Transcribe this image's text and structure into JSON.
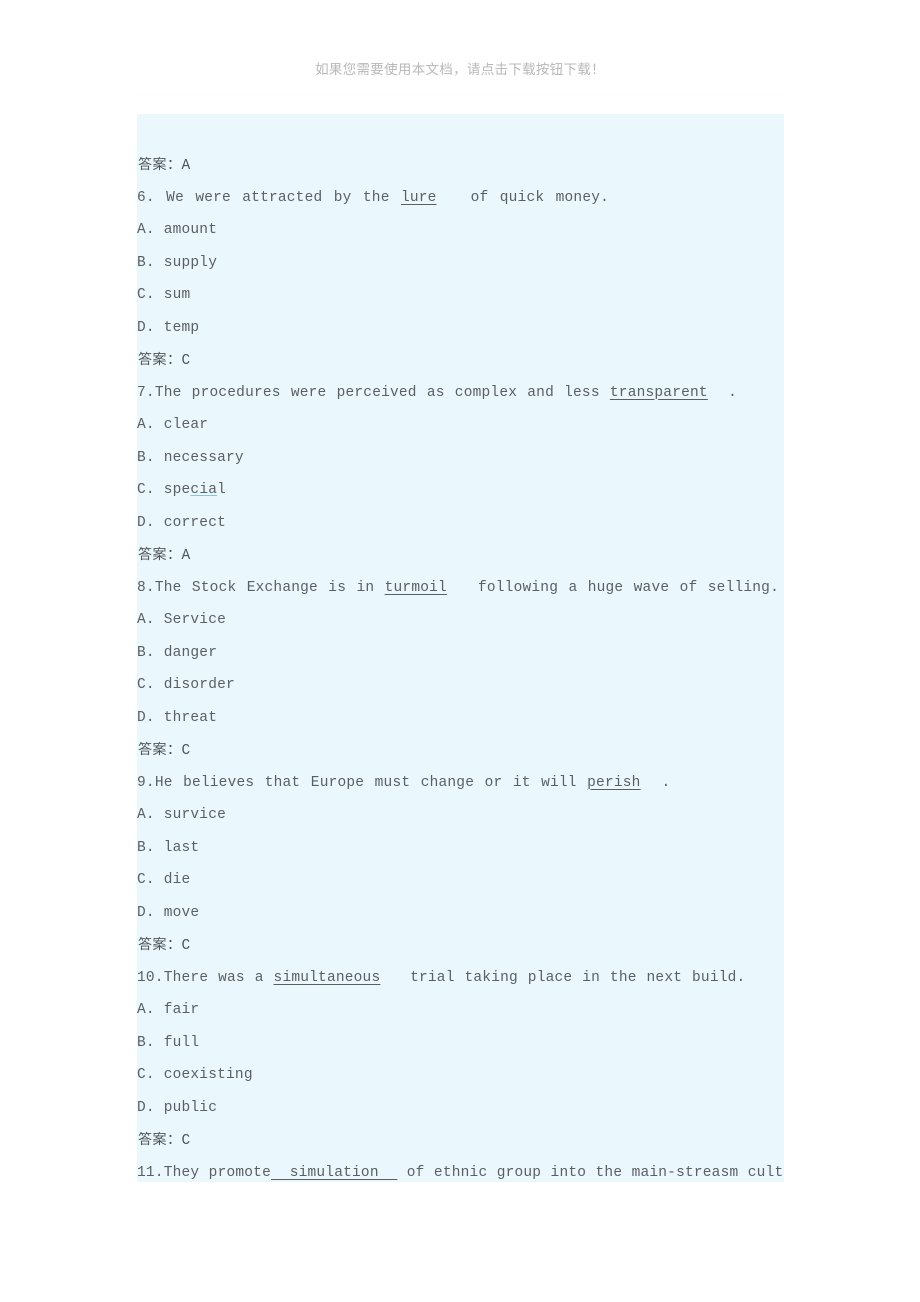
{
  "banner": {
    "text": "如果您需要使用本文档，请点击下载按钮下载！",
    "color": "#b9b9b9"
  },
  "document": {
    "background_color": "#eaf8fd",
    "text_color": "#5a5f63",
    "answer_label": "答案：",
    "lines": [
      {
        "kind": "answer",
        "label": "答案：",
        "value": "A"
      },
      {
        "kind": "question",
        "number": "6.",
        "before": " We were attracted by the ",
        "keyword": "lure",
        "after": " of quick money.",
        "keyword_style": "underline"
      },
      {
        "kind": "option",
        "text": "A. amount"
      },
      {
        "kind": "option",
        "text": "B. supply"
      },
      {
        "kind": "option",
        "text": "C. sum"
      },
      {
        "kind": "option",
        "text": "D. temp"
      },
      {
        "kind": "answer",
        "label": "答案：",
        "value": "C"
      },
      {
        "kind": "question",
        "number": "7.",
        "before": "The procedures were perceived as complex and less ",
        "keyword": "transparent",
        "after": ".",
        "keyword_style": "underline"
      },
      {
        "kind": "option",
        "text": "A. clear"
      },
      {
        "kind": "option",
        "text": "B. necessary"
      },
      {
        "kind": "option",
        "text": "C. special",
        "spellcheck_part": "cia",
        "spellcheck_prefix": "C. spe",
        "spellcheck_suffix": "l"
      },
      {
        "kind": "option",
        "text": "D. correct"
      },
      {
        "kind": "answer",
        "label": "答案：",
        "value": "A"
      },
      {
        "kind": "question",
        "number": "8.",
        "before": "The Stock Exchange is in ",
        "keyword": "turmoil",
        "after": " following a huge wave of selling.",
        "keyword_style": "underline"
      },
      {
        "kind": "option",
        "text": "A. Service"
      },
      {
        "kind": "option",
        "text": "B. danger"
      },
      {
        "kind": "option",
        "text": "C. disorder"
      },
      {
        "kind": "option",
        "text": "D. threat"
      },
      {
        "kind": "answer",
        "label": "答案：",
        "value": "C"
      },
      {
        "kind": "question",
        "number": "9.",
        "before": "He believes that Europe must change or it will ",
        "keyword": "perish",
        "after": ".",
        "keyword_style": "underline"
      },
      {
        "kind": "option",
        "text": "A. survice"
      },
      {
        "kind": "option",
        "text": "B. last"
      },
      {
        "kind": "option",
        "text": "C. die"
      },
      {
        "kind": "option",
        "text": "D. move"
      },
      {
        "kind": "answer",
        "label": "答案：",
        "value": "C"
      },
      {
        "kind": "question",
        "number": "10.",
        "before": "There was a ",
        "keyword": "simultaneous",
        "after": " trial taking place in the next build.",
        "keyword_style": "underline"
      },
      {
        "kind": "option",
        "text": "A. fair"
      },
      {
        "kind": "option",
        "text": "B. full"
      },
      {
        "kind": "option",
        "text": "C. coexisting"
      },
      {
        "kind": "option",
        "text": "D. public"
      },
      {
        "kind": "answer",
        "label": "答案：",
        "value": "C"
      },
      {
        "kind": "question",
        "number": "11.",
        "before": "They promote",
        "keyword": "  simulation  ",
        "after": "of ethnic group into the main-streasm culture.",
        "keyword_style": "blank"
      }
    ]
  }
}
